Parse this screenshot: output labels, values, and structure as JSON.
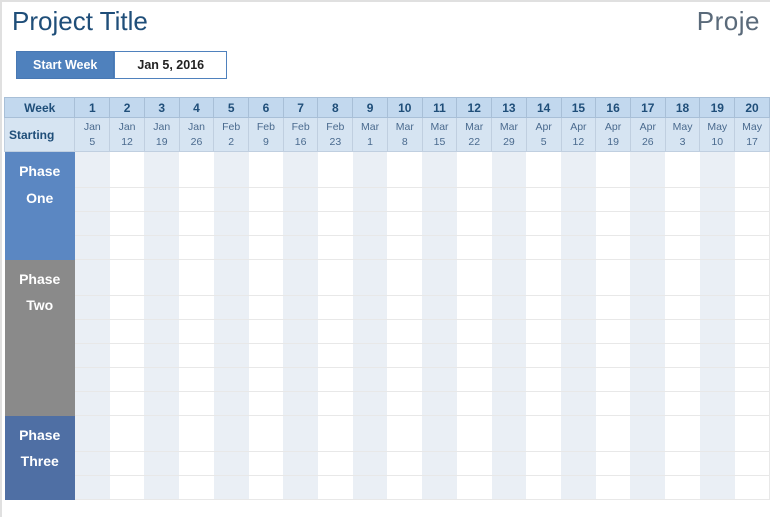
{
  "header": {
    "title_left": "Project Title",
    "title_right": "Proje"
  },
  "start_week": {
    "label": "Start Week",
    "value": "Jan 5, 2016"
  },
  "grid": {
    "week_label": "Week",
    "starting_label": "Starting",
    "week_numbers": [
      "1",
      "2",
      "3",
      "4",
      "5",
      "6",
      "7",
      "8",
      "9",
      "10",
      "11",
      "12",
      "13",
      "14",
      "15",
      "16",
      "17",
      "18",
      "19",
      "20"
    ],
    "week_dates": [
      "Jan 5",
      "Jan 12",
      "Jan 19",
      "Jan 26",
      "Feb 2",
      "Feb 9",
      "Feb 16",
      "Feb 23",
      "Mar 1",
      "Mar 8",
      "Mar 15",
      "Mar 22",
      "Mar 29",
      "Apr 5",
      "Apr 12",
      "Apr 19",
      "Apr 26",
      "May 3",
      "May 10",
      "May 17"
    ]
  },
  "phases": [
    {
      "label": "Phase One",
      "rows": 4,
      "color_class": "phase-one"
    },
    {
      "label": "Phase Two",
      "rows": 6,
      "color_class": "phase-two"
    },
    {
      "label": "Phase Three",
      "rows": 3,
      "color_class": "phase-three"
    }
  ],
  "colors": {
    "accent": "#4f81bd",
    "header_text": "#1f4e79",
    "phase_one": "#5b87c2",
    "phase_two": "#8a8a8a",
    "phase_three": "#4f6fa4"
  },
  "chart_data": {
    "type": "table",
    "title": "Project Title",
    "start_week": "Jan 5, 2016",
    "weeks": [
      {
        "num": 1,
        "start": "Jan 5"
      },
      {
        "num": 2,
        "start": "Jan 12"
      },
      {
        "num": 3,
        "start": "Jan 19"
      },
      {
        "num": 4,
        "start": "Jan 26"
      },
      {
        "num": 5,
        "start": "Feb 2"
      },
      {
        "num": 6,
        "start": "Feb 9"
      },
      {
        "num": 7,
        "start": "Feb 16"
      },
      {
        "num": 8,
        "start": "Feb 23"
      },
      {
        "num": 9,
        "start": "Mar 1"
      },
      {
        "num": 10,
        "start": "Mar 8"
      },
      {
        "num": 11,
        "start": "Mar 15"
      },
      {
        "num": 12,
        "start": "Mar 22"
      },
      {
        "num": 13,
        "start": "Mar 29"
      },
      {
        "num": 14,
        "start": "Apr 5"
      },
      {
        "num": 15,
        "start": "Apr 12"
      },
      {
        "num": 16,
        "start": "Apr 19"
      },
      {
        "num": 17,
        "start": "Apr 26"
      },
      {
        "num": 18,
        "start": "May 3"
      },
      {
        "num": 19,
        "start": "May 10"
      },
      {
        "num": 20,
        "start": "May 17"
      }
    ],
    "phases": [
      "Phase One",
      "Phase Two",
      "Phase Three"
    ]
  }
}
